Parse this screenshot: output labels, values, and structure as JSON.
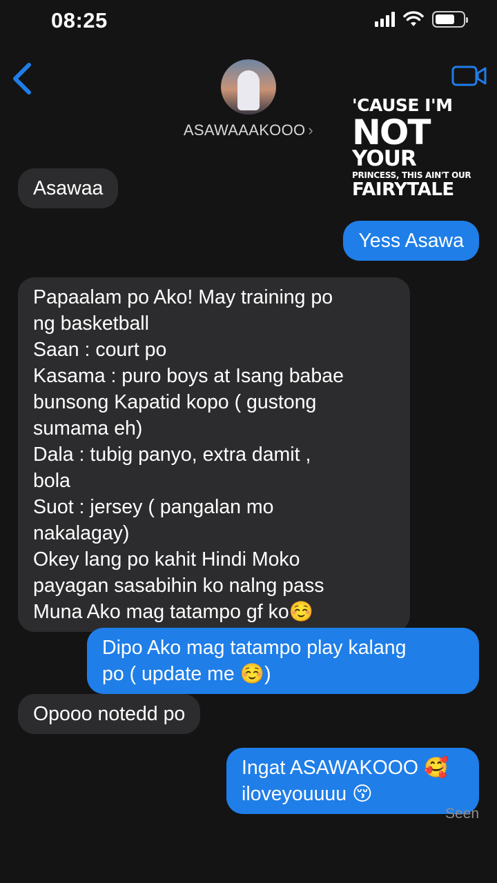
{
  "status_bar": {
    "time": "08:25"
  },
  "header": {
    "contact_name": "ASAWAAAKOOO",
    "chevron": "›",
    "icons": {
      "back": "chevron-left-icon",
      "video": "video-camera-icon"
    },
    "accent_color": "#1f7ee8"
  },
  "overlay_text": {
    "line1": "'CAUSE I'M",
    "line2": "NOT",
    "line3": "YOUR",
    "line4": "PRINCESS, THIS AIN'T OUR",
    "line5": "FAIRYTALE"
  },
  "messages": [
    {
      "sender": "contact",
      "text": "Asawaa"
    },
    {
      "sender": "me",
      "text": "Yess Asawa"
    },
    {
      "sender": "contact",
      "text": "Papaalam po Ako! May training po\nng basketball\nSaan : court po\nKasama : puro boys at Isang babae\nbunsong Kapatid kopo ( gustong\nsumama eh)\nDala : tubig panyo, extra damit ,\nbola\nSuot : jersey ( pangalan mo\nnakalagay)\nOkey lang po kahit Hindi Moko\npayagan sasabihin ko nalng pass\nMuna Ako mag tatampo gf ko☺️"
    },
    {
      "sender": "me",
      "text": "Dipo Ako mag tatampo play kalang\npo ( update me ☺️)"
    },
    {
      "sender": "contact",
      "text": "Opooo notedd po"
    },
    {
      "sender": "me",
      "text": "Ingat ASAWAKOOO 🥰\niloveyouuuu 😚"
    }
  ],
  "read_receipt": "Seen",
  "colors": {
    "background": "#141414",
    "received_bubble": "#2c2c2e",
    "sent_bubble": "#1f7ee8"
  }
}
